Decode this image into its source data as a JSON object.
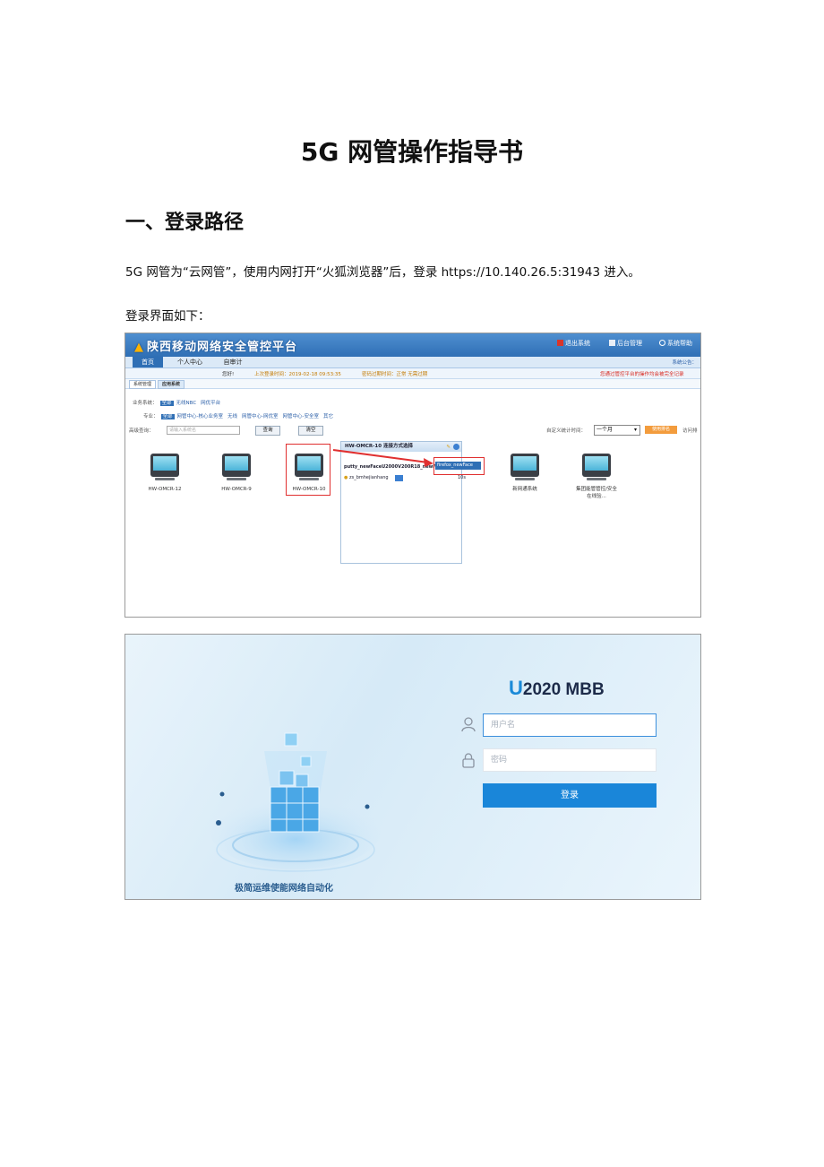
{
  "doc": {
    "title": "5G 网管操作指导书",
    "section1": "一、登录路径",
    "para1": "5G 网管为“云网管”，使用内网打开“火狐浏览器”后，登录 https://10.140.26.5:31943 进入。",
    "para2": "登录界面如下："
  },
  "portal": {
    "app_title": "陕西移动网络安全管控平台",
    "top_buttons": [
      "退出系统",
      "后台管理",
      "系统帮助"
    ],
    "nav_tabs": [
      "首页",
      "个人中心",
      "自审计"
    ],
    "notice": "系统公告：",
    "info_left": "您好!",
    "info_last_login": "上次登录时间：2019-02-18 09:53:35",
    "info_pwd": "密码过期时间：正常 无需过期",
    "info_warn": "您通过管控平台的操作均会被完全记录",
    "sub_tabs": [
      "系统管理",
      "应用系统"
    ],
    "row_business_label": "业务系统：",
    "row_business_items": [
      "全部",
      "无线NBC",
      "网优平台"
    ],
    "row_major_label": "专业：",
    "row_major_items": [
      "全部",
      "网管中心-核心业务室",
      "无线",
      "网管中心-网优室",
      "网管中心-安全室",
      "其它"
    ],
    "query_label": "高级查询：",
    "query_placeholder": "请输入系统名",
    "btn_query": "查询",
    "btn_clear": "清空",
    "stat_label": "自定义统计时间：",
    "stat_value": "一个月",
    "btn_orange": "使用排名",
    "btn_visit": "访问排",
    "monitors": [
      {
        "label": "HW-OMCR-12"
      },
      {
        "label": "HW-OMCR-9"
      },
      {
        "label": "HW-OMCR-10"
      },
      {
        "label": "新网通系统"
      },
      {
        "label": "集团能管管控/安全"
      },
      {
        "label": "在线验..."
      }
    ],
    "popup_title": "HW-OMCR-10 连接方式选择",
    "popup_row1": "putty_newFaceU2000V200R18_newFace",
    "popup_sel": "firefox_newFace",
    "popup_row2": "zs_bmhejianhang",
    "popup_row2_val": "10s"
  },
  "login": {
    "brand_u": "U",
    "brand": "2020 MBB",
    "username_placeholder": "用户名",
    "password_placeholder": "密码",
    "login_button": "登录",
    "slogan": "极简运维使能网络自动化"
  }
}
